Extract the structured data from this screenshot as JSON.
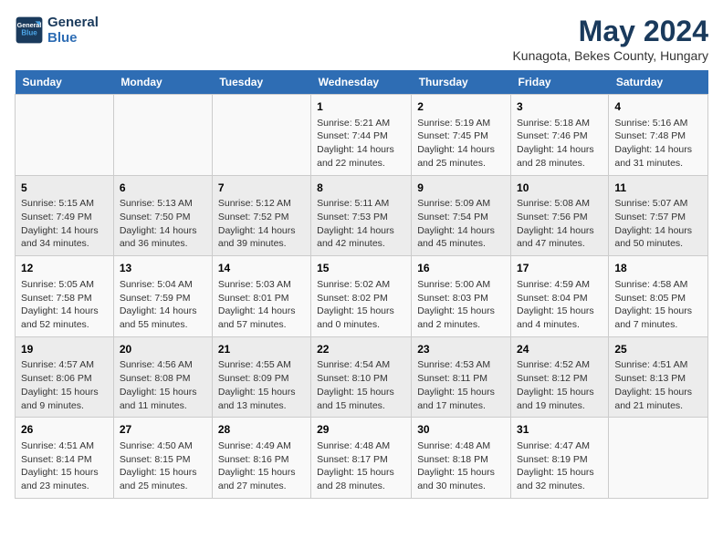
{
  "logo": {
    "line1": "General",
    "line2": "Blue"
  },
  "title": "May 2024",
  "location": "Kunagota, Bekes County, Hungary",
  "days_header": [
    "Sunday",
    "Monday",
    "Tuesday",
    "Wednesday",
    "Thursday",
    "Friday",
    "Saturday"
  ],
  "weeks": [
    [
      {
        "day": "",
        "info": ""
      },
      {
        "day": "",
        "info": ""
      },
      {
        "day": "",
        "info": ""
      },
      {
        "day": "1",
        "info": "Sunrise: 5:21 AM\nSunset: 7:44 PM\nDaylight: 14 hours\nand 22 minutes."
      },
      {
        "day": "2",
        "info": "Sunrise: 5:19 AM\nSunset: 7:45 PM\nDaylight: 14 hours\nand 25 minutes."
      },
      {
        "day": "3",
        "info": "Sunrise: 5:18 AM\nSunset: 7:46 PM\nDaylight: 14 hours\nand 28 minutes."
      },
      {
        "day": "4",
        "info": "Sunrise: 5:16 AM\nSunset: 7:48 PM\nDaylight: 14 hours\nand 31 minutes."
      }
    ],
    [
      {
        "day": "5",
        "info": "Sunrise: 5:15 AM\nSunset: 7:49 PM\nDaylight: 14 hours\nand 34 minutes."
      },
      {
        "day": "6",
        "info": "Sunrise: 5:13 AM\nSunset: 7:50 PM\nDaylight: 14 hours\nand 36 minutes."
      },
      {
        "day": "7",
        "info": "Sunrise: 5:12 AM\nSunset: 7:52 PM\nDaylight: 14 hours\nand 39 minutes."
      },
      {
        "day": "8",
        "info": "Sunrise: 5:11 AM\nSunset: 7:53 PM\nDaylight: 14 hours\nand 42 minutes."
      },
      {
        "day": "9",
        "info": "Sunrise: 5:09 AM\nSunset: 7:54 PM\nDaylight: 14 hours\nand 45 minutes."
      },
      {
        "day": "10",
        "info": "Sunrise: 5:08 AM\nSunset: 7:56 PM\nDaylight: 14 hours\nand 47 minutes."
      },
      {
        "day": "11",
        "info": "Sunrise: 5:07 AM\nSunset: 7:57 PM\nDaylight: 14 hours\nand 50 minutes."
      }
    ],
    [
      {
        "day": "12",
        "info": "Sunrise: 5:05 AM\nSunset: 7:58 PM\nDaylight: 14 hours\nand 52 minutes."
      },
      {
        "day": "13",
        "info": "Sunrise: 5:04 AM\nSunset: 7:59 PM\nDaylight: 14 hours\nand 55 minutes."
      },
      {
        "day": "14",
        "info": "Sunrise: 5:03 AM\nSunset: 8:01 PM\nDaylight: 14 hours\nand 57 minutes."
      },
      {
        "day": "15",
        "info": "Sunrise: 5:02 AM\nSunset: 8:02 PM\nDaylight: 15 hours\nand 0 minutes."
      },
      {
        "day": "16",
        "info": "Sunrise: 5:00 AM\nSunset: 8:03 PM\nDaylight: 15 hours\nand 2 minutes."
      },
      {
        "day": "17",
        "info": "Sunrise: 4:59 AM\nSunset: 8:04 PM\nDaylight: 15 hours\nand 4 minutes."
      },
      {
        "day": "18",
        "info": "Sunrise: 4:58 AM\nSunset: 8:05 PM\nDaylight: 15 hours\nand 7 minutes."
      }
    ],
    [
      {
        "day": "19",
        "info": "Sunrise: 4:57 AM\nSunset: 8:06 PM\nDaylight: 15 hours\nand 9 minutes."
      },
      {
        "day": "20",
        "info": "Sunrise: 4:56 AM\nSunset: 8:08 PM\nDaylight: 15 hours\nand 11 minutes."
      },
      {
        "day": "21",
        "info": "Sunrise: 4:55 AM\nSunset: 8:09 PM\nDaylight: 15 hours\nand 13 minutes."
      },
      {
        "day": "22",
        "info": "Sunrise: 4:54 AM\nSunset: 8:10 PM\nDaylight: 15 hours\nand 15 minutes."
      },
      {
        "day": "23",
        "info": "Sunrise: 4:53 AM\nSunset: 8:11 PM\nDaylight: 15 hours\nand 17 minutes."
      },
      {
        "day": "24",
        "info": "Sunrise: 4:52 AM\nSunset: 8:12 PM\nDaylight: 15 hours\nand 19 minutes."
      },
      {
        "day": "25",
        "info": "Sunrise: 4:51 AM\nSunset: 8:13 PM\nDaylight: 15 hours\nand 21 minutes."
      }
    ],
    [
      {
        "day": "26",
        "info": "Sunrise: 4:51 AM\nSunset: 8:14 PM\nDaylight: 15 hours\nand 23 minutes."
      },
      {
        "day": "27",
        "info": "Sunrise: 4:50 AM\nSunset: 8:15 PM\nDaylight: 15 hours\nand 25 minutes."
      },
      {
        "day": "28",
        "info": "Sunrise: 4:49 AM\nSunset: 8:16 PM\nDaylight: 15 hours\nand 27 minutes."
      },
      {
        "day": "29",
        "info": "Sunrise: 4:48 AM\nSunset: 8:17 PM\nDaylight: 15 hours\nand 28 minutes."
      },
      {
        "day": "30",
        "info": "Sunrise: 4:48 AM\nSunset: 8:18 PM\nDaylight: 15 hours\nand 30 minutes."
      },
      {
        "day": "31",
        "info": "Sunrise: 4:47 AM\nSunset: 8:19 PM\nDaylight: 15 hours\nand 32 minutes."
      },
      {
        "day": "",
        "info": ""
      }
    ]
  ]
}
